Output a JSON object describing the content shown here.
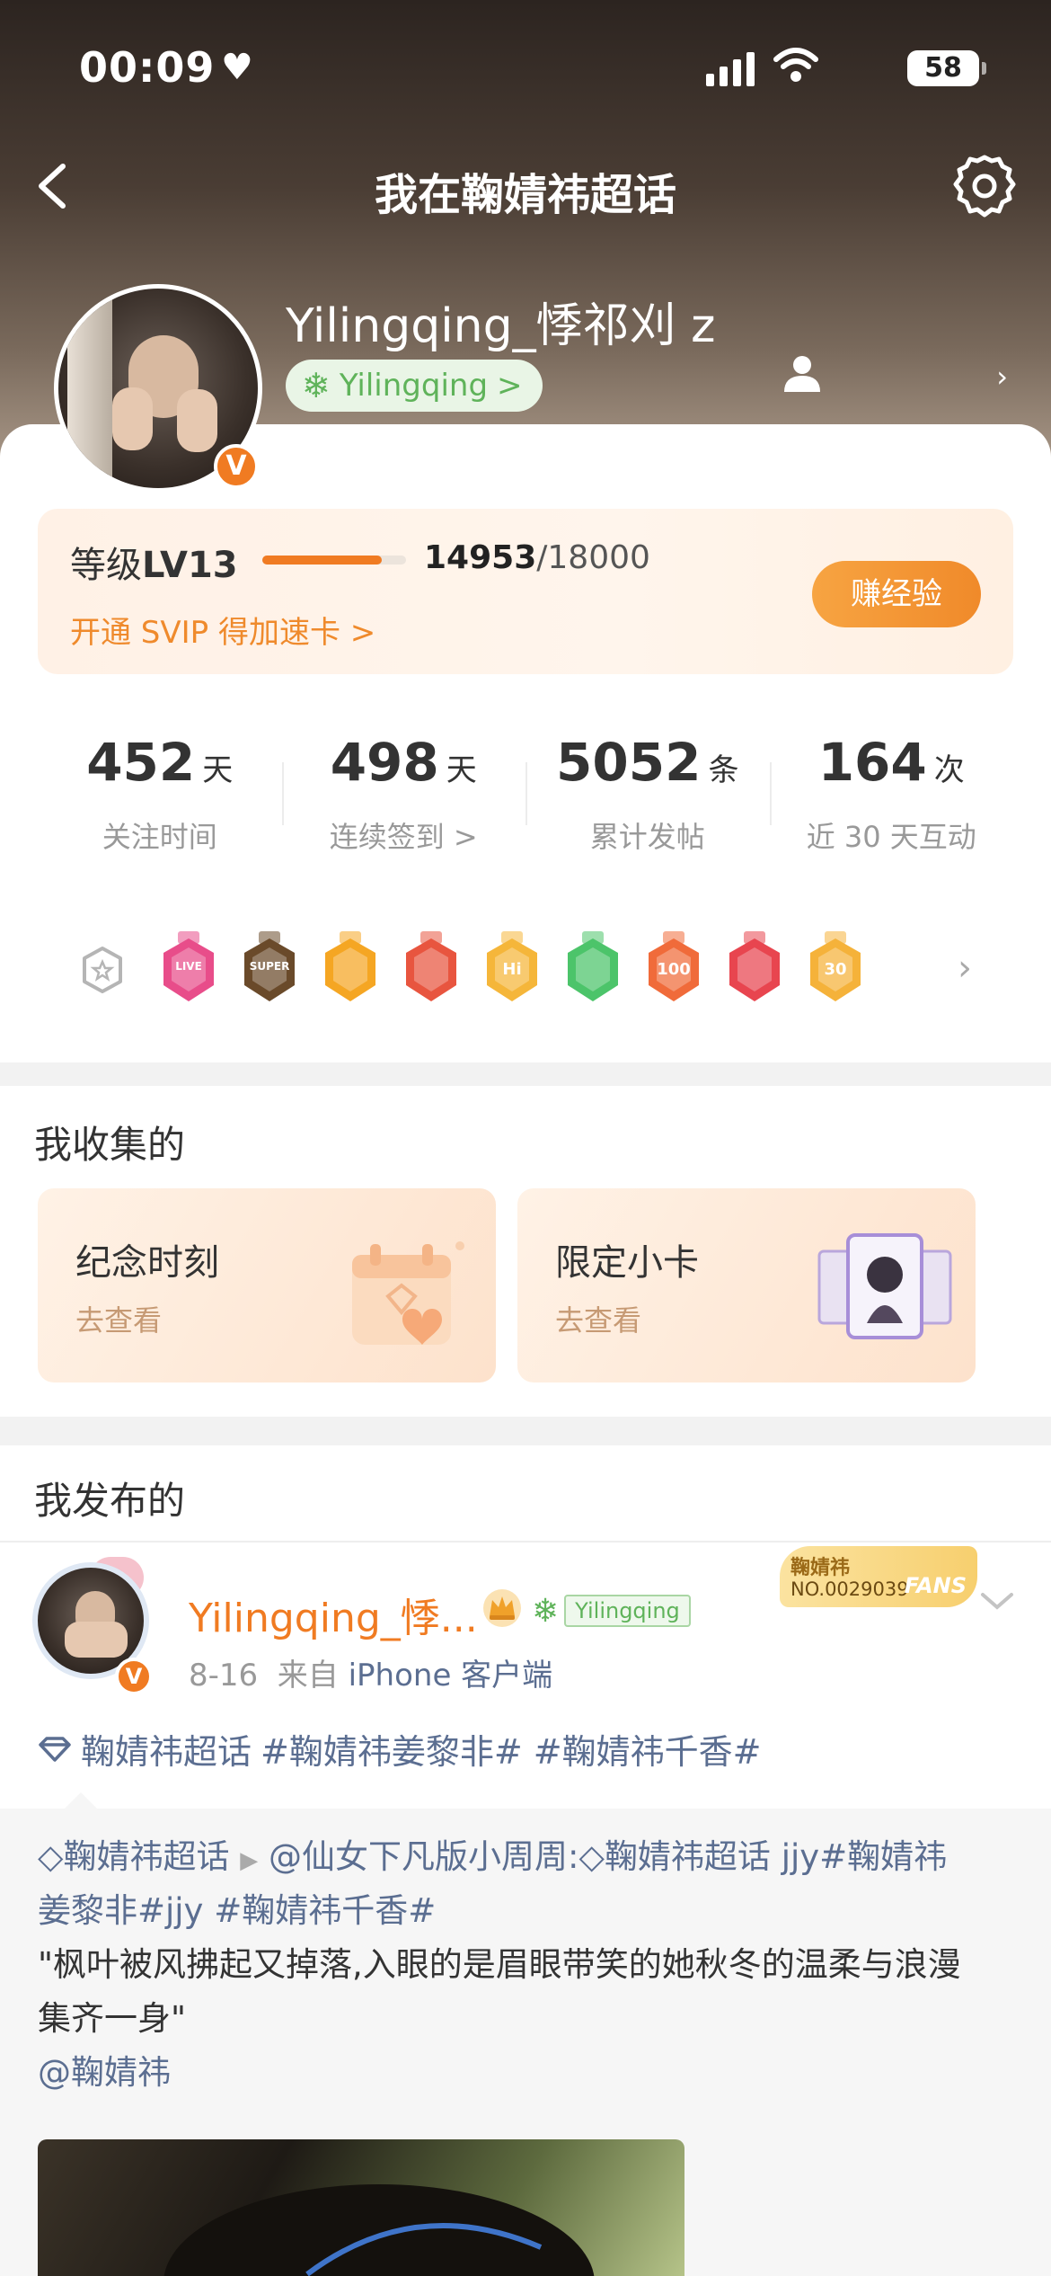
{
  "status_bar": {
    "time": "00:09",
    "battery": "58"
  },
  "nav": {
    "title": "我在鞠婧祎超话"
  },
  "profile": {
    "username": "Yilingqing_悸祁刈 z",
    "chip_label": "Yilingqing",
    "chip_arrow": ">"
  },
  "level": {
    "label_prefix": "等级",
    "level": "LV13",
    "progress": 0.83,
    "current": "14953",
    "total": "/18000",
    "svip_text": "开通 SVIP 得加速卡 >",
    "earn_button": "赚经验"
  },
  "stats": [
    {
      "value": "452",
      "unit": "天",
      "label": "关注时间"
    },
    {
      "value": "498",
      "unit": "天",
      "label": "连续签到 >"
    },
    {
      "value": "5052",
      "unit": "条",
      "label": "累计发帖"
    },
    {
      "value": "164",
      "unit": "次",
      "label": "近 30 天互动"
    }
  ],
  "medals": [
    {
      "name": "live-medal",
      "text": "LIVE",
      "color": "#e84d8a"
    },
    {
      "name": "super-medal",
      "text": "SUPER",
      "color": "#6a4a2a"
    },
    {
      "name": "crown-medal",
      "text": "",
      "color": "#f5a623"
    },
    {
      "name": "cat-medal",
      "text": "",
      "color": "#e8553f"
    },
    {
      "name": "hi-medal",
      "text": "Hi",
      "color": "#f5b63a"
    },
    {
      "name": "hand-medal",
      "text": "",
      "color": "#4cc46a"
    },
    {
      "name": "100-days-medal",
      "text": "100",
      "color": "#f06b3a"
    },
    {
      "name": "trophy-medal",
      "text": "",
      "color": "#e8454f"
    },
    {
      "name": "30-days-medal",
      "text": "30",
      "color": "#f5b23a"
    }
  ],
  "collect": {
    "title": "我收集的",
    "cards": [
      {
        "title": "纪念时刻",
        "sub": "去查看"
      },
      {
        "title": "限定小卡",
        "sub": "去查看"
      }
    ]
  },
  "posts_section": {
    "title": "我发布的"
  },
  "post": {
    "author": "Yilingqing_悸...",
    "chip_label": "Yilingqing",
    "fan_badge_name": "鞠婧祎",
    "fan_badge_no": "NO.0029039",
    "fan_badge_word": "FANS",
    "date": "8-16",
    "source_prefix": "来自",
    "source_device": "iPhone 客户端",
    "topic": "鞠婧祎超话",
    "hashtags": "#鞠婧祎姜黎非# #鞠婧祎千香#"
  },
  "repost": {
    "topic": "鞠婧祎超话",
    "author": "@仙女下凡版小周周:",
    "inner_topic": "鞠婧祎超话",
    "line1_tail": "jjy#鞠婧祎",
    "line2": "姜黎非#jjy #鞠婧祎千香#",
    "line3": "\"枫叶被风拂起又掉落,入眼的是眉眼带笑的她秋冬的温柔与浪漫",
    "line4": "集齐一身\"",
    "mention": "@鞠婧祎"
  }
}
